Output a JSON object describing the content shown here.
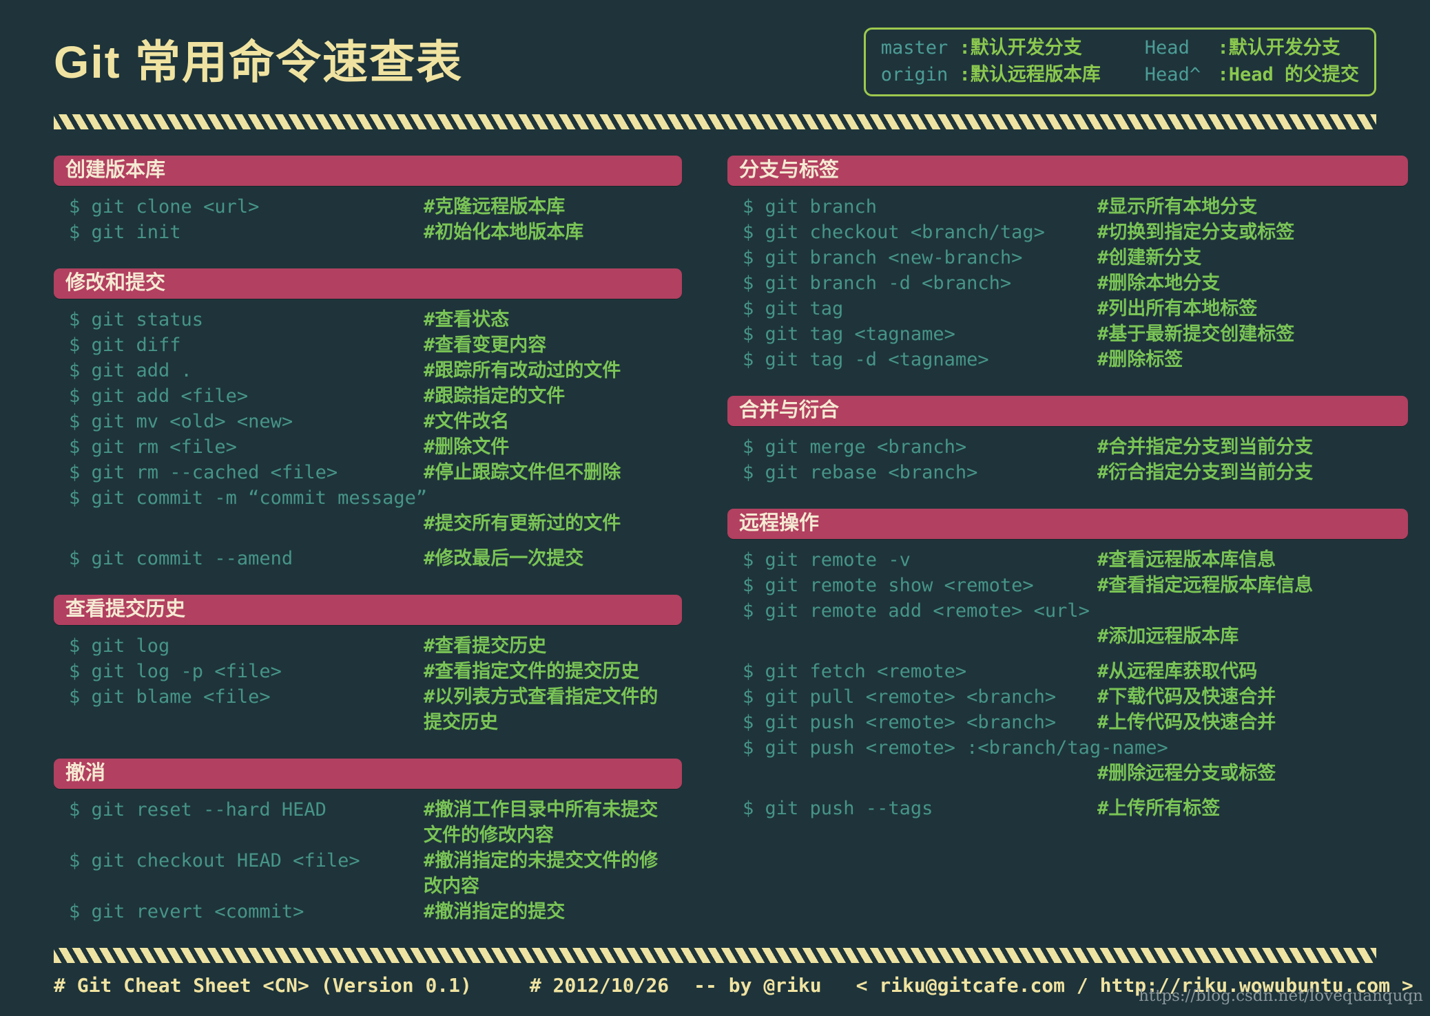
{
  "page": {
    "title": "Git 常用命令速查表",
    "watermark": "https://blog.csdn.net/lovequanquqn"
  },
  "colors": {
    "background": "#1e343a",
    "section_header_bg": "#b24060",
    "section_header_text": "#f5ead3",
    "command_text": "#479489",
    "comment_text": "#7ac456",
    "accent_cream": "#f0e3a1",
    "legend_border": "#9ec94e",
    "legend_term": "#4d9d97",
    "legend_desc": "#8bc84f",
    "watermark_text": "#8b979c"
  },
  "legend": {
    "entries": [
      {
        "term": "master",
        "desc": ":默认开发分支"
      },
      {
        "term": "origin",
        "desc": ":默认远程版本库"
      },
      {
        "term": "Head",
        "desc": ":默认开发分支"
      },
      {
        "term": "Head^",
        "desc": ":Head 的父提交"
      }
    ]
  },
  "columns": {
    "left": [
      {
        "title": "创建版本库",
        "rows": [
          {
            "c": "$ git clone <url>",
            "d": "#克隆远程版本库"
          },
          {
            "c": "$ git init",
            "d": "#初始化本地版本库"
          }
        ]
      },
      {
        "title": "修改和提交",
        "rows": [
          {
            "c": "$ git status",
            "d": "#查看状态"
          },
          {
            "c": "$ git diff",
            "d": "#查看变更内容"
          },
          {
            "c": "$ git add .",
            "d": "#跟踪所有改动过的文件"
          },
          {
            "c": "$ git add <file>",
            "d": "#跟踪指定的文件"
          },
          {
            "c": "$ git mv <old> <new>",
            "d": "#文件改名"
          },
          {
            "c": "$ git rm <file>",
            "d": "#删除文件"
          },
          {
            "c": "$ git rm --cached <file>",
            "d": "#停止跟踪文件但不删除"
          },
          {
            "c": "$ git commit -m “commit message”",
            "d": ""
          },
          {
            "c": "",
            "d": "#提交所有更新过的文件"
          },
          {
            "c": "",
            "d": ""
          },
          {
            "c": "$ git commit --amend",
            "d": "#修改最后一次提交"
          }
        ]
      },
      {
        "title": "查看提交历史",
        "rows": [
          {
            "c": "$ git log",
            "d": "#查看提交历史"
          },
          {
            "c": "$ git log -p <file>",
            "d": "#查看指定文件的提交历史"
          },
          {
            "c": "$ git blame <file>",
            "d": "#以列表方式查看指定文件的提交历史"
          }
        ]
      },
      {
        "title": "撤消",
        "rows": [
          {
            "c": "$ git reset --hard HEAD",
            "d": "#撤消工作目录中所有未提交文件的修改内容"
          },
          {
            "c": "$ git checkout HEAD <file>",
            "d": "#撤消指定的未提交文件的修改内容"
          },
          {
            "c": "$ git revert <commit>",
            "d": "#撤消指定的提交"
          }
        ]
      }
    ],
    "right": [
      {
        "title": "分支与标签",
        "rows": [
          {
            "c": "$ git branch",
            "d": "#显示所有本地分支"
          },
          {
            "c": "$ git checkout <branch/tag>",
            "d": "#切换到指定分支或标签"
          },
          {
            "c": "$ git branch <new-branch>",
            "d": "#创建新分支"
          },
          {
            "c": "$ git branch -d <branch>",
            "d": "#删除本地分支"
          },
          {
            "c": "$ git tag",
            "d": "#列出所有本地标签"
          },
          {
            "c": "$ git tag <tagname>",
            "d": "#基于最新提交创建标签"
          },
          {
            "c": "$ git tag -d <tagname>",
            "d": "#删除标签"
          }
        ]
      },
      {
        "title": "合并与衍合",
        "rows": [
          {
            "c": "$ git merge <branch>",
            "d": "#合并指定分支到当前分支"
          },
          {
            "c": "$ git rebase <branch>",
            "d": "#衍合指定分支到当前分支"
          }
        ]
      },
      {
        "title": "远程操作",
        "rows": [
          {
            "c": "$ git remote -v",
            "d": "#查看远程版本库信息"
          },
          {
            "c": "$ git remote show <remote>",
            "d": "#查看指定远程版本库信息"
          },
          {
            "c": "$ git remote add <remote> <url>",
            "d": ""
          },
          {
            "c": "",
            "d": "#添加远程版本库"
          },
          {
            "c": "",
            "d": ""
          },
          {
            "c": "$ git fetch <remote>",
            "d": "#从远程库获取代码"
          },
          {
            "c": "$ git pull <remote> <branch>",
            "d": "#下载代码及快速合并"
          },
          {
            "c": "$ git push <remote> <branch>",
            "d": "#上传代码及快速合并"
          },
          {
            "c": "$ git push <remote> :<branch/tag-name>",
            "d": ""
          },
          {
            "c": "",
            "d": "#删除远程分支或标签"
          },
          {
            "c": "",
            "d": ""
          },
          {
            "c": "$ git push --tags",
            "d": "#上传所有标签"
          }
        ]
      }
    ]
  },
  "footer": {
    "sheet": "# Git Cheat Sheet <CN> (Version 0.1)",
    "date": "# 2012/10/26",
    "author": "-- by @riku",
    "contact": "< riku@gitcafe.com / http://riku.wowubuntu.com >"
  }
}
